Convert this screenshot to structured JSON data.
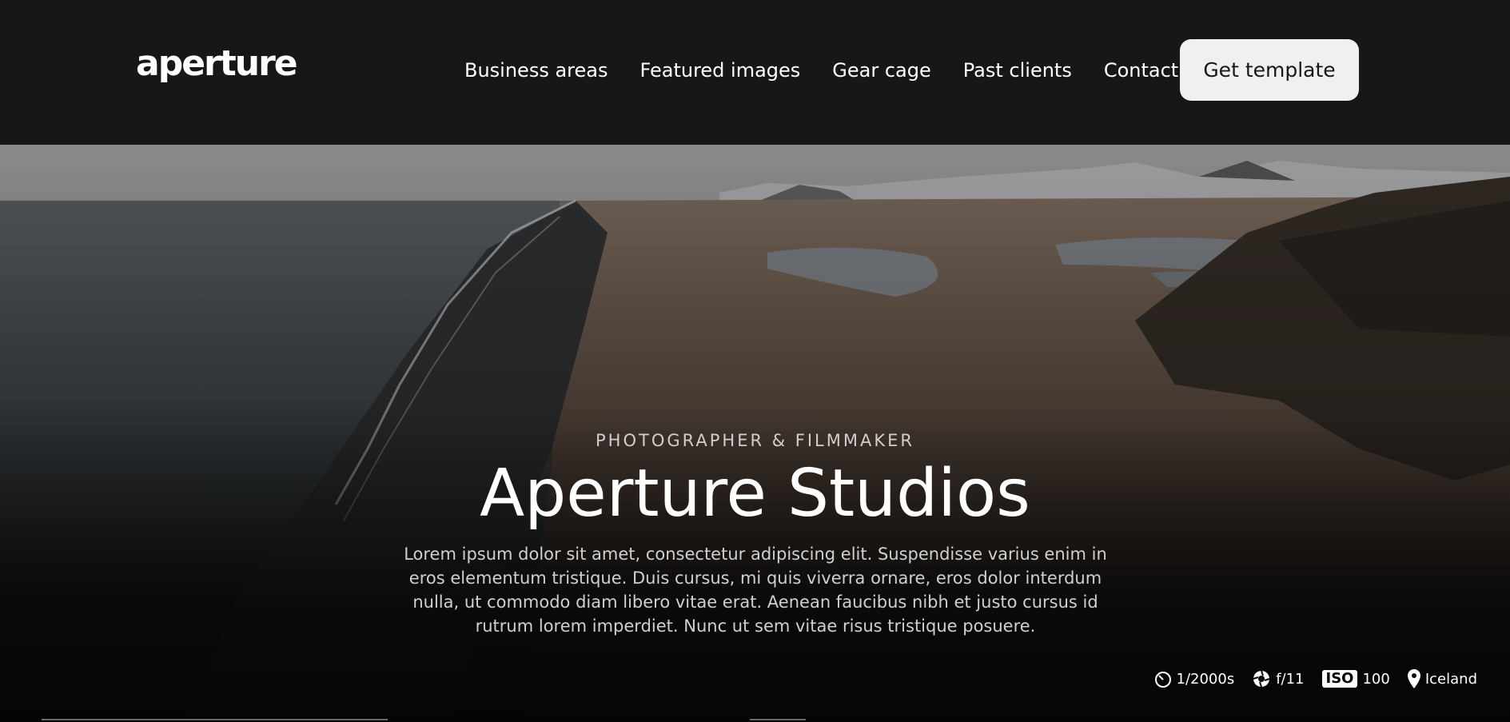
{
  "nav": {
    "logo_text": "aperture",
    "links": [
      "Business areas",
      "Featured images",
      "Gear cage",
      "Past clients",
      "Contact"
    ],
    "cta_label": "Get template"
  },
  "hero": {
    "eyebrow": "PHOTOGRAPHER & FILMMAKER",
    "title": "Aperture Studios",
    "description": "Lorem ipsum dolor sit amet, consectetur adipiscing elit. Suspendisse varius enim in eros elementum tristique. Duis cursus, mi quis viverra ornare, eros dolor interdum nulla, ut commodo diam libero vitae erat. Aenean faucibus nibh et justo cursus id rutrum lorem imperdiet. Nunc ut sem vitae risus tristique posuere.",
    "meta": {
      "shutter": "1/2000s",
      "aperture": "f/11",
      "iso_label": "ISO",
      "iso_value": "100",
      "location": "Iceland"
    },
    "icons": {
      "shutter": "stopwatch-icon",
      "aperture": "aperture-icon",
      "iso": "iso-badge",
      "location": "map-pin-icon"
    }
  },
  "colors": {
    "background": "#171717",
    "cta_background": "#f0f0f0",
    "text": "#ffffff"
  }
}
